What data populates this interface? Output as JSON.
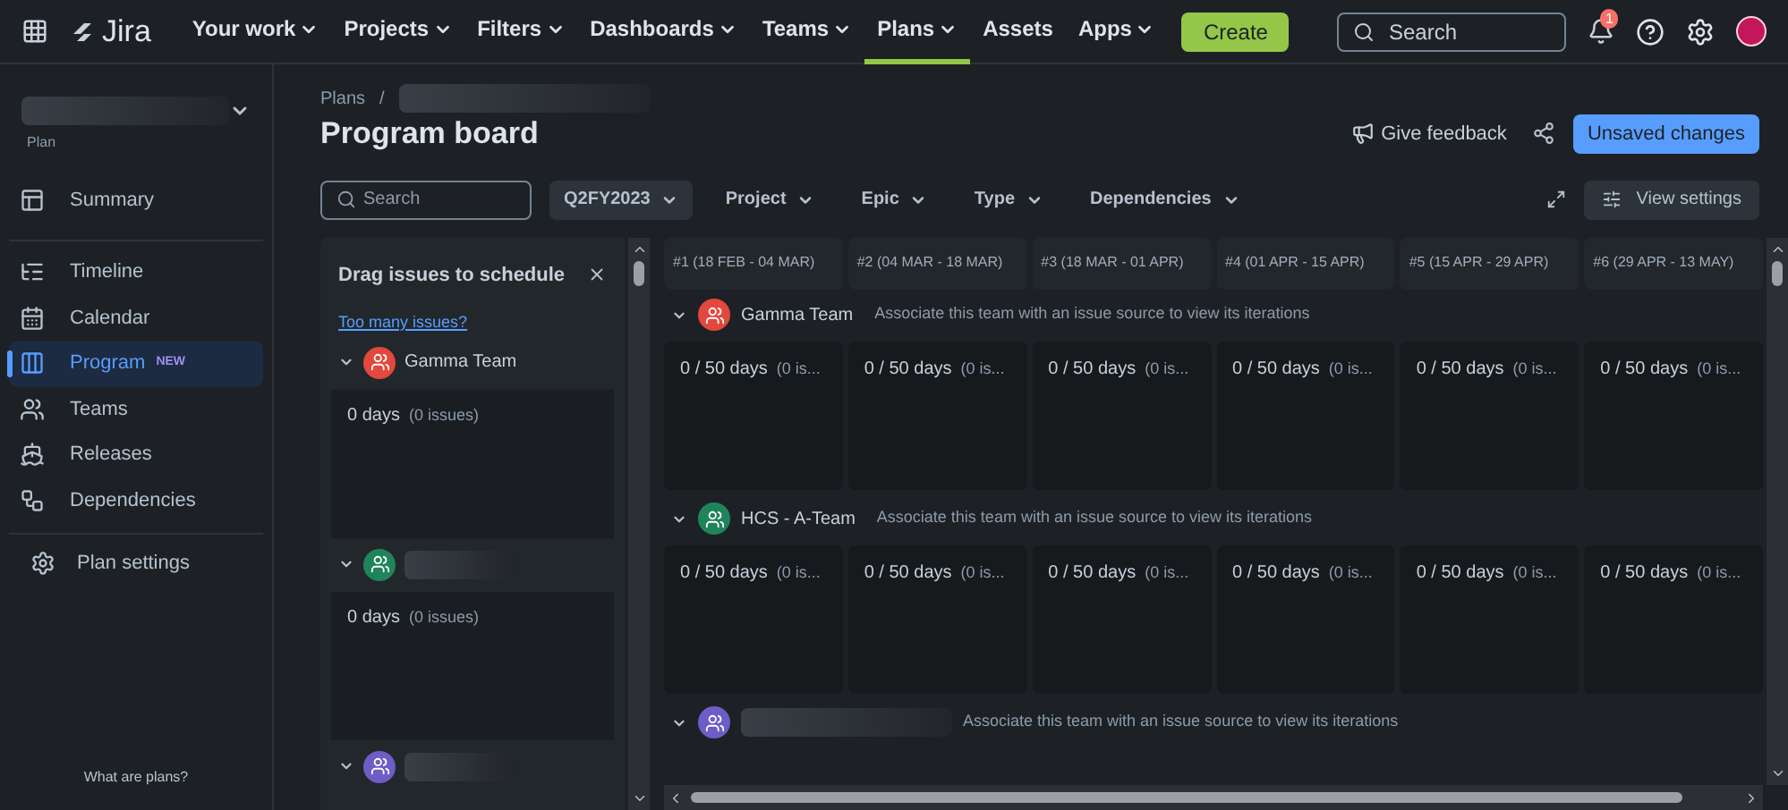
{
  "nav": {
    "product": "Jira",
    "items": [
      {
        "label": "Your work",
        "dropdown": true,
        "selected": false
      },
      {
        "label": "Projects",
        "dropdown": true,
        "selected": false
      },
      {
        "label": "Filters",
        "dropdown": true,
        "selected": false
      },
      {
        "label": "Dashboards",
        "dropdown": true,
        "selected": false
      },
      {
        "label": "Teams",
        "dropdown": true,
        "selected": false
      },
      {
        "label": "Plans",
        "dropdown": true,
        "selected": true
      },
      {
        "label": "Assets",
        "dropdown": false,
        "selected": false
      },
      {
        "label": "Apps",
        "dropdown": true,
        "selected": false
      }
    ],
    "create": "Create",
    "search_placeholder": "Search",
    "notification_count": "1"
  },
  "sidebar": {
    "plan_label": "Plan",
    "groups": [
      [
        {
          "label": "Summary",
          "kind": "summary",
          "selected": false
        }
      ],
      [
        {
          "label": "Timeline",
          "kind": "timeline",
          "selected": false
        },
        {
          "label": "Calendar",
          "kind": "calendar",
          "selected": false
        },
        {
          "label": "Program",
          "kind": "program",
          "selected": true,
          "badge": "NEW"
        },
        {
          "label": "Teams",
          "kind": "teams",
          "selected": false
        },
        {
          "label": "Releases",
          "kind": "releases",
          "selected": false
        },
        {
          "label": "Dependencies",
          "kind": "dependencies",
          "selected": false
        }
      ]
    ],
    "settings": "Plan settings",
    "footer_link": "What are plans?"
  },
  "header": {
    "breadcrumb": "Plans",
    "separator": "/",
    "title": "Program board",
    "feedback": "Give feedback",
    "primary_button": "Unsaved changes"
  },
  "filters": {
    "search_placeholder": "Search",
    "items": [
      {
        "label": "Q2FY2023",
        "kind": "value"
      },
      {
        "label": "Project",
        "kind": "filter"
      },
      {
        "label": "Epic",
        "kind": "filter"
      },
      {
        "label": "Type",
        "kind": "filter"
      },
      {
        "label": "Dependencies",
        "kind": "filter"
      }
    ],
    "view_settings": "View settings"
  },
  "unscheduled": {
    "title": "Drag issues to schedule",
    "link": "Too many issues?",
    "teams": [
      {
        "name": "Gamma Team",
        "color": "#e2483d",
        "days": "0 days",
        "issues": "(0 issues)"
      },
      {
        "color": "#1f845a",
        "days": "0 days",
        "issues": "(0 issues)"
      },
      {
        "color": "#6e5dc6"
      }
    ]
  },
  "board": {
    "iterations": [
      "#1 (18 FEB - 04 MAR)",
      "#2 (04 MAR - 18 MAR)",
      "#3 (18 MAR - 01 APR)",
      "#4 (01 APR - 15 APR)",
      "#5 (15 APR - 29 APR)",
      "#6 (29 APR - 13 MAY)"
    ],
    "teams": [
      {
        "name": "Gamma Team",
        "color": "#e2483d",
        "note": "Associate this team with an issue source to view its iterations",
        "cells": [
          {
            "capacity": "0 / 50 days",
            "issues": "(0 is..."
          },
          {
            "capacity": "0 / 50 days",
            "issues": "(0 is..."
          },
          {
            "capacity": "0 / 50 days",
            "issues": "(0 is..."
          },
          {
            "capacity": "0 / 50 days",
            "issues": "(0 is..."
          },
          {
            "capacity": "0 / 50 days",
            "issues": "(0 is..."
          },
          {
            "capacity": "0 / 50 days",
            "issues": "(0 is..."
          }
        ]
      },
      {
        "name": "HCS - A-Team",
        "color": "#1f845a",
        "note": "Associate this team with an issue source to view its iterations",
        "cells": [
          {
            "capacity": "0 / 50 days",
            "issues": "(0 is..."
          },
          {
            "capacity": "0 / 50 days",
            "issues": "(0 is..."
          },
          {
            "capacity": "0 / 50 days",
            "issues": "(0 is..."
          },
          {
            "capacity": "0 / 50 days",
            "issues": "(0 is..."
          },
          {
            "capacity": "0 / 50 days",
            "issues": "(0 is..."
          },
          {
            "capacity": "0 / 50 days",
            "issues": "(0 is..."
          }
        ]
      },
      {
        "color": "#6e5dc6",
        "note": "Associate this team with an issue source to view its iterations"
      }
    ]
  }
}
